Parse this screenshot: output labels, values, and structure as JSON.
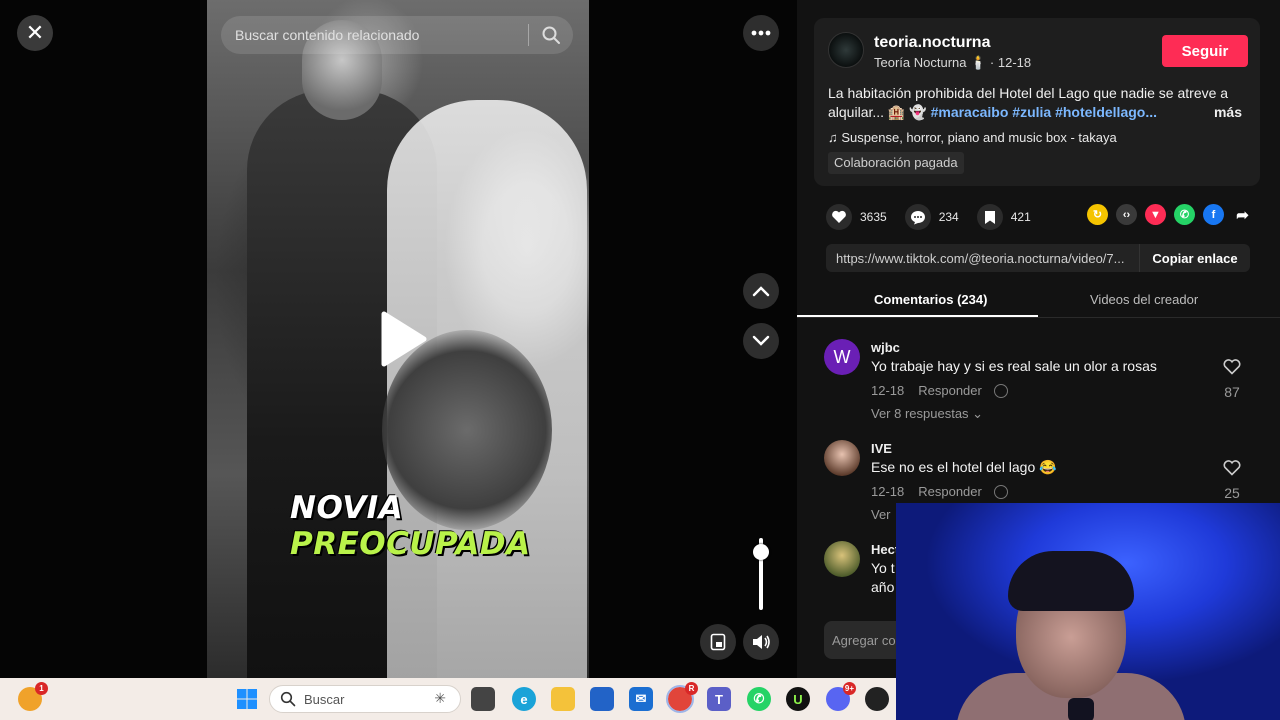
{
  "player": {
    "search_placeholder": "Buscar contenido relacionado",
    "caption_line1": "NOVIA",
    "caption_line2": "PREOCUPADA",
    "volume_level": 0.8
  },
  "video_info": {
    "username": "teoria.nocturna",
    "display_name": "Teoría Nocturna",
    "date": "12-18",
    "follow_label": "Seguir",
    "description": "La habitación prohibida del Hotel del Lago que nadie se atreve a alquilar... 🏨 👻",
    "hashtags": [
      "#maracaibo",
      "#zulia",
      "#hoteldellago..."
    ],
    "more_label": "más",
    "music": "Suspense, horror, piano and music box - takaya",
    "paid_label": "Colaboración pagada"
  },
  "stats": {
    "likes": "3635",
    "comments": "234",
    "saves": "421"
  },
  "share": {
    "link": "https://www.tiktok.com/@teoria.nocturna/video/7...",
    "copy_label": "Copiar enlace"
  },
  "tabs": {
    "comments": "Comentarios (234)",
    "creator_videos": "Videos del creador"
  },
  "comments": [
    {
      "user": "wjbc",
      "avatar_letter": "W",
      "text": "Yo trabaje hay y si es real sale un olor a rosas",
      "date": "12-18",
      "reply": "Responder",
      "likes": "87",
      "more": "Ver 8 respuestas ⌄"
    },
    {
      "user": "IVE",
      "avatar_letter": "",
      "text": "Ese no es el hotel del lago 😂",
      "date": "12-18",
      "reply": "Responder",
      "likes": "25",
      "more": "Ver"
    },
    {
      "user": "Hect",
      "avatar_letter": "",
      "text": "Yo t",
      "text2": "año",
      "date": "",
      "reply": "",
      "likes": "",
      "more": ""
    }
  ],
  "add_comment_placeholder": "Agregar co",
  "taskbar": {
    "search_label": "Buscar",
    "chrome_badge": "R",
    "discord_badge": "9+",
    "weather_badge": "1"
  },
  "colors": {
    "accent": "#fe2c55",
    "tag": "#7cb8ff",
    "caption_green": "#b9f24a"
  }
}
